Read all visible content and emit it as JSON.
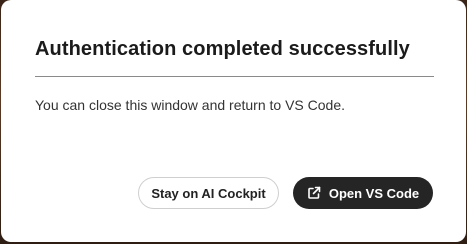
{
  "dialog": {
    "title": "Authentication completed successfully",
    "message": "You can close this window and return to VS Code."
  },
  "actions": {
    "secondary_label": "Stay on AI Cockpit",
    "primary_label": "Open VS Code",
    "primary_icon": "external-link-icon"
  },
  "colors": {
    "primary_button_bg": "#252525",
    "secondary_button_border": "#cfcfcf",
    "dialog_bg": "#ffffff"
  }
}
